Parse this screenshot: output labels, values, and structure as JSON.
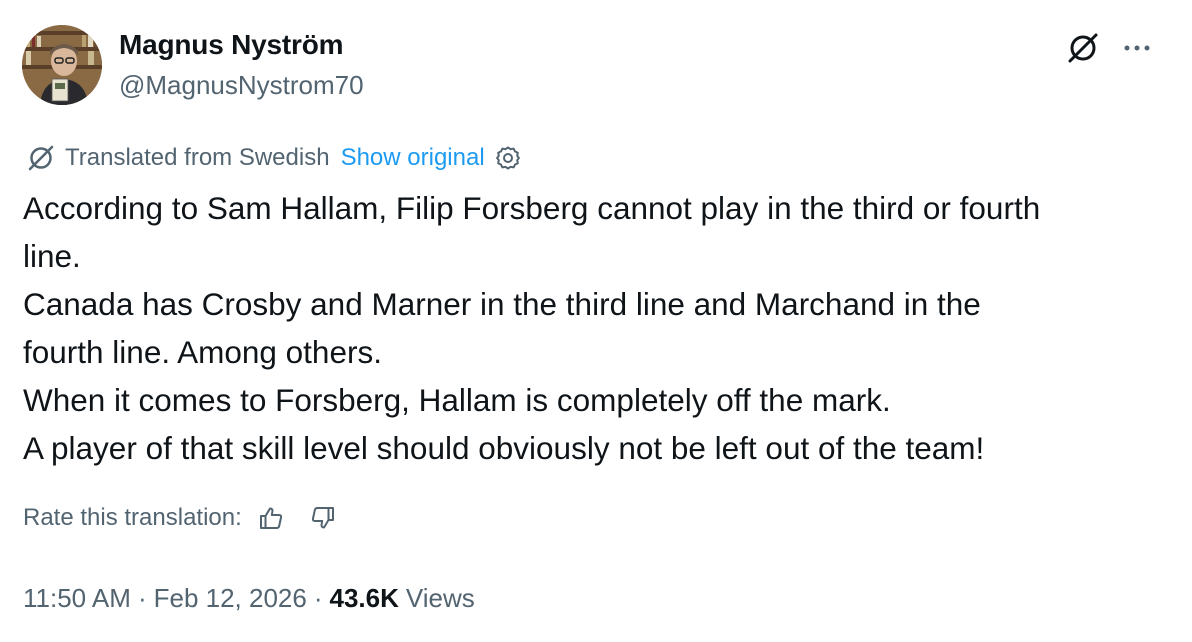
{
  "author": {
    "name": "Magnus Nyström",
    "handle": "@MagnusNystrom70",
    "avatar_icon": "profile-photo"
  },
  "header_icons": {
    "grok": "grok-icon",
    "more": "more-icon"
  },
  "translation": {
    "label": "Translated from Swedish",
    "show_original": "Show original",
    "rate_label": "Rate this translation:"
  },
  "body": {
    "lines": [
      "According to Sam Hallam, Filip Forsberg cannot play in the third or fourth",
      "line.",
      "Canada has Crosby and Marner in the third line and Marchand in the",
      "fourth line. Among others.",
      "When it comes to Forsberg, Hallam is completely off the mark.",
      "A player of that skill level should obviously not be left out of the team!"
    ]
  },
  "meta": {
    "time": "11:50 AM",
    "date": "Feb 12, 2026",
    "separator": "·",
    "views_count": "43.6K",
    "views_label": "Views"
  },
  "colors": {
    "text": "#0f1419",
    "secondary": "#536471",
    "link": "#1d9bf0"
  }
}
